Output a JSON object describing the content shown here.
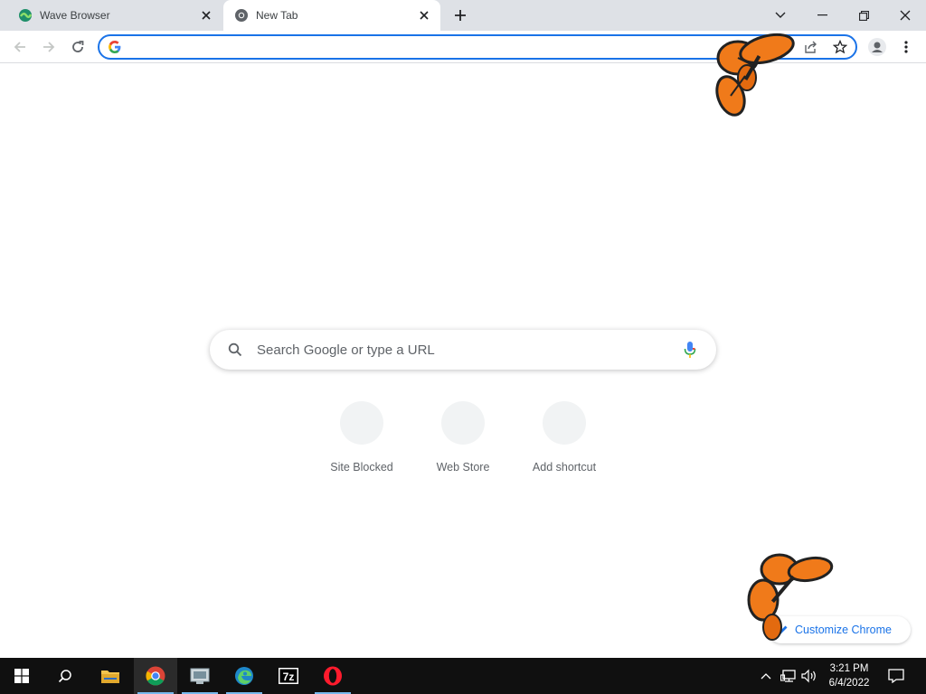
{
  "tabs": [
    {
      "title": "Wave Browser",
      "active": false,
      "icon": "wave-browser-icon"
    },
    {
      "title": "New Tab",
      "active": true,
      "icon": "chrome-icon"
    }
  ],
  "window_controls": [
    "chevron-down-icon",
    "minimize-icon",
    "restore-icon",
    "close-icon"
  ],
  "omnibox": {
    "value": "",
    "placeholder": ""
  },
  "ntp": {
    "search_placeholder": "Search Google or type a URL",
    "shortcuts": [
      {
        "label": "Site Blocked"
      },
      {
        "label": "Web Store"
      },
      {
        "label": "Add shortcut"
      }
    ],
    "customize_label": "Customize Chrome"
  },
  "taskbar": {
    "apps": [
      "windows-start-icon",
      "search-icon",
      "file-explorer-icon",
      "chrome-icon",
      "network-app-icon",
      "edge-icon",
      "7zip-icon",
      "opera-icon"
    ],
    "time": "3:21 PM",
    "date": "6/4/2022"
  },
  "colors": {
    "accent": "#1a73e8",
    "tabstrip": "#dee1e6",
    "taskbar": "#101010",
    "butterfly": "#f07a1a"
  }
}
